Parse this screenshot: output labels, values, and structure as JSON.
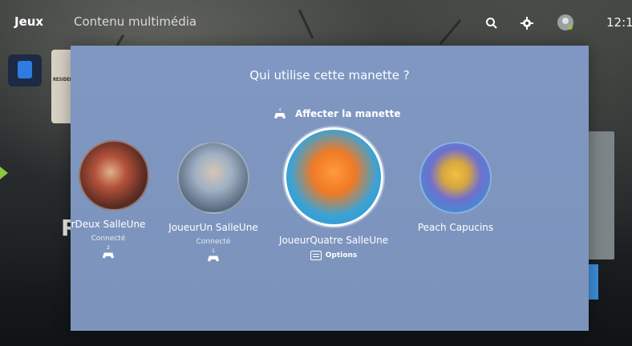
{
  "topbar": {
    "tabs": [
      "Jeux",
      "Contenu multimédia"
    ],
    "icons": [
      "search-icon",
      "gear-icon",
      "profile-avatar"
    ],
    "clock": "12:1"
  },
  "background": {
    "cover_text": "RESIDEN",
    "title_fragment": "RI"
  },
  "dialog": {
    "title": "Qui utilise cette manette ?",
    "assign_label": "Affecter la manette",
    "assign_badge": "4",
    "users": [
      {
        "name": "rDeux SalleUne",
        "status": "Connecté",
        "controller": "2",
        "avatar_color": "#b03a2e"
      },
      {
        "name": "JoueurUn SalleUne",
        "status": "Connecté",
        "controller": "1",
        "avatar_color": "#5d7fa8"
      },
      {
        "name": "JoueurQuatre SalleUne",
        "options_label": "Options",
        "avatar_color": "#3aa3d6",
        "selected": true
      },
      {
        "name": "Peach Capucins",
        "avatar_color": "#3f8fd0"
      }
    ]
  },
  "colors": {
    "dialog_bg": "#7e96bf",
    "accent_green": "#8dc63f",
    "store_blue": "#2f7be0"
  }
}
